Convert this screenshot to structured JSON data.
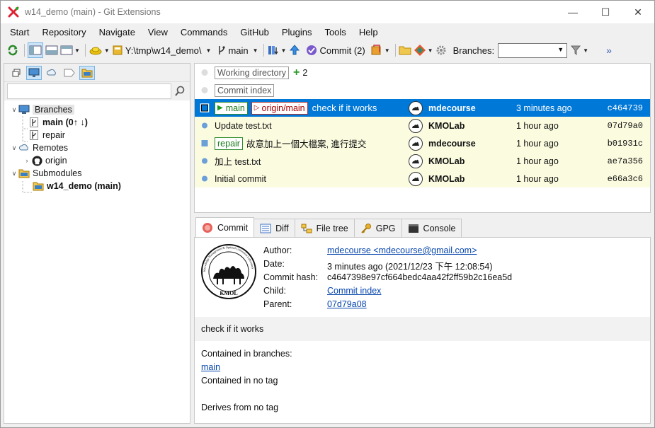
{
  "window": {
    "title": "w14_demo (main) - Git Extensions",
    "controls": [
      "—",
      "☐",
      "✕"
    ]
  },
  "menu": [
    "Start",
    "Repository",
    "Navigate",
    "View",
    "Commands",
    "GitHub",
    "Plugins",
    "Tools",
    "Help"
  ],
  "toolbar": {
    "repo_path": "Y:\\tmp\\w14_demo\\",
    "branch": "main",
    "commit_label": "Commit (2)",
    "branches_label": "Branches:",
    "branches_value": "",
    "overflow": "»"
  },
  "sidebar": {
    "search_value": "",
    "branches_label": "Branches",
    "branch_main": "main (0↑ ↓)",
    "branch_repair": "repair",
    "remotes_label": "Remotes",
    "remote_origin": "origin",
    "submodules_label": "Submodules",
    "submodule_item": "w14_demo (main)"
  },
  "revisions": {
    "working_dir": "Working directory",
    "working_dir_count": "2",
    "commit_index": "Commit index",
    "commits": [
      {
        "refs_local": "main",
        "refs_remote": "origin/main",
        "message": "check if it works",
        "author": "mdecourse",
        "date": "3 minutes ago",
        "hash": "c464739"
      },
      {
        "message": "Update test.txt",
        "author": "KMOLab",
        "date": "1 hour ago",
        "hash": "07d79a0"
      },
      {
        "refs_local": "repair",
        "message": "故意加上一個大檔案, 進行提交",
        "author": "mdecourse",
        "date": "1 hour ago",
        "hash": "b01931c"
      },
      {
        "message": "加上 test.txt",
        "author": "KMOLab",
        "date": "1 hour ago",
        "hash": "ae7a356"
      },
      {
        "message": "Initial commit",
        "author": "KMOLab",
        "date": "1 hour ago",
        "hash": "e66a3c6"
      }
    ]
  },
  "tabs": [
    "Commit",
    "Diff",
    "File tree",
    "GPG",
    "Console"
  ],
  "commit_info": {
    "author_label": "Author:",
    "author_value": "mdecourse <mdecourse@gmail.com>",
    "date_label": "Date:",
    "date_value": "3 minutes ago (2021/12/23 下午 12:08:54)",
    "hash_label": "Commit hash:",
    "hash_value": "c4647398e97cf664bedc4aa42f2ff59b2c16ea5d",
    "child_label": "Child:",
    "child_value": "Commit index",
    "parent_label": "Parent:",
    "parent_value": "07d79a08",
    "message": "check if it works",
    "contained_label": "Contained in branches:",
    "contained_branch": "main",
    "no_tag": "Contained in no tag",
    "derives": "Derives from no tag"
  },
  "logo": {
    "text_ring": "Knowledge Management & Optimal Utilization Laboratory",
    "text_bottom": "KMOL"
  },
  "colors": {
    "selection": "#0078d7",
    "row_highlight": "#fbfbe0",
    "local_ref": "#1a7a1a",
    "remote_ref": "#aa0000",
    "graph_line": "#7fb0e0"
  }
}
